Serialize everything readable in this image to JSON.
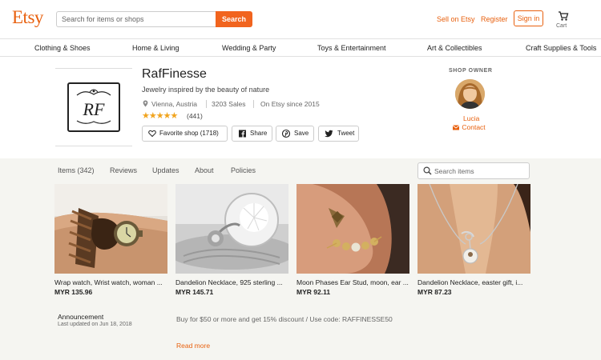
{
  "header": {
    "logo": "Etsy",
    "search_placeholder": "Search for items or shops",
    "search_button": "Search",
    "sell_on_etsy": "Sell on Etsy",
    "register": "Register",
    "sign_in": "Sign in",
    "cart_label": "Cart"
  },
  "nav": {
    "categories": [
      "Clothing & Shoes",
      "Home & Living",
      "Wedding & Party",
      "Toys & Entertainment",
      "Art & Collectibles",
      "Craft Supplies & Tools"
    ]
  },
  "shop": {
    "logo_text": "RF",
    "name": "RafFinesse",
    "tagline": "Jewelry inspired by the beauty of nature",
    "location": "Vienna, Austria",
    "sales": "3203 Sales",
    "since": "On Etsy since 2015",
    "stars": "★★★★★",
    "rating": 5,
    "review_count": "(441)",
    "buttons": {
      "favorite": "Favorite shop (1718)",
      "share": "Share",
      "save": "Save",
      "tweet": "Tweet"
    }
  },
  "owner": {
    "label": "SHOP OWNER",
    "name": "Lucia",
    "contact": "Contact"
  },
  "tabs": [
    "Items (342)",
    "Reviews",
    "Updates",
    "About",
    "Policies"
  ],
  "items_search_placeholder": "Search items",
  "listings": [
    {
      "title": "Wrap watch, Wrist watch, woman ...",
      "price": "MYR 135.96"
    },
    {
      "title": "Dandelion Necklace, 925 sterling ...",
      "price": "MYR 145.71"
    },
    {
      "title": "Moon Phases Ear Stud, moon, ear ...",
      "price": "MYR 92.11"
    },
    {
      "title": "Dandelion Necklace, easter gift, i...",
      "price": "MYR 87.23"
    }
  ],
  "announcement": {
    "title": "Announcement",
    "updated": "Last updated on Jun 18, 2018",
    "body": "Buy for $50 or more and get 15% discount / Use code: RAFFINESSE50",
    "read_more": "Read more"
  },
  "colors": {
    "brand": "#f1641e",
    "link": "#e8600e",
    "star": "#f1a41e",
    "main_bg": "#f5f5f1"
  }
}
